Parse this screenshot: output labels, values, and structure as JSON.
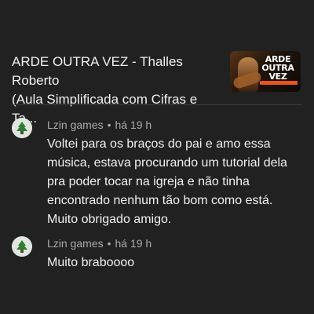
{
  "video": {
    "title": "ARDE OUTRA VEZ - Thalles Roberto\n(Aula Simplificada com Cifras e Ta...",
    "thumbnail_text": "ARDE\nOUTRA VEZ"
  },
  "comments": [
    {
      "author": "Lzin games",
      "separator": "•",
      "time": "há 19 h",
      "text": "Voltei para os braços do pai e amo essa\nmúsica, estava procurando um tutorial dela\npra poder tocar na igreja e não tinha\nencontrado nenhum tão bom como está.\nMuito obrigado amigo.",
      "avatar_icon": "tree-avatar-icon"
    },
    {
      "author": "Lzin games",
      "separator": "•",
      "time": "há 19 h",
      "text": "Muito braboooo",
      "avatar_icon": "tree-avatar-icon"
    }
  ],
  "colors": {
    "background": "#212121",
    "text_primary": "#f1f1f1",
    "text_secondary": "#aaaaaa",
    "divider": "#3d3d3d",
    "thumbnail_accent": "#e8541c"
  }
}
